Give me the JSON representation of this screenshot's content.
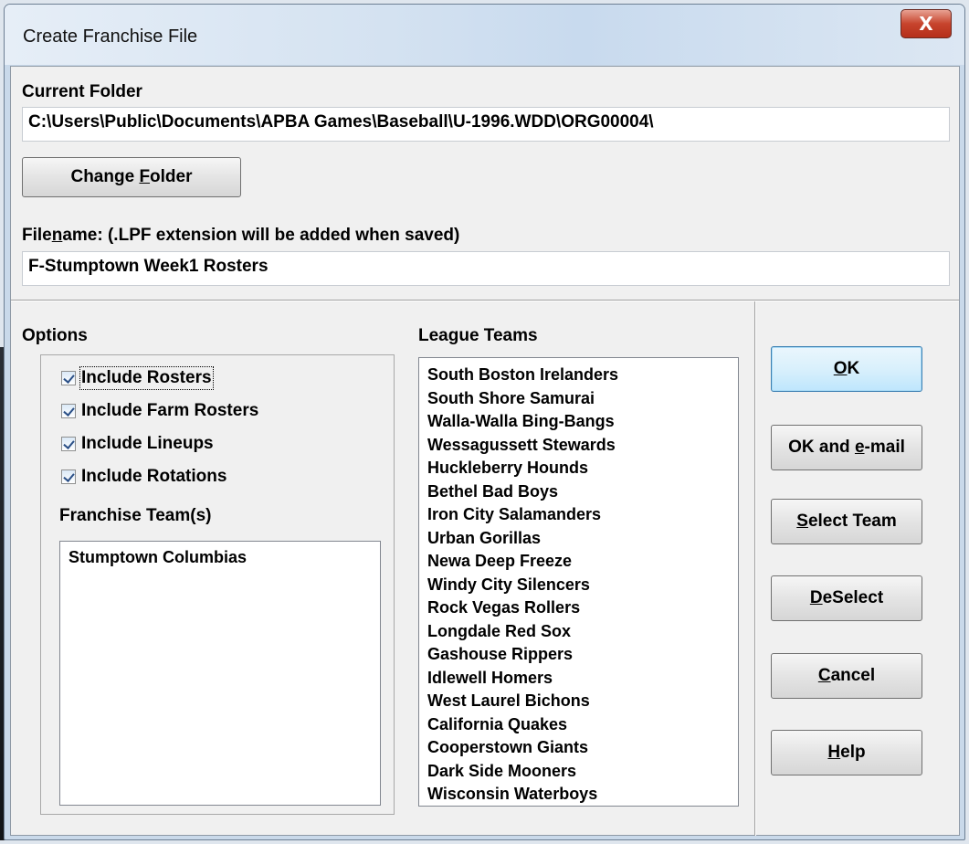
{
  "window": {
    "title": "Create Franchise File",
    "close_glyph": "X"
  },
  "current_folder": {
    "label": "Current Folder",
    "value": "C:\\Users\\Public\\Documents\\APBA Games\\Baseball\\U-1996.WDD\\ORG00004\\"
  },
  "change_folder_button": {
    "prefix": "Change ",
    "mnemonic": "F",
    "suffix": "older"
  },
  "filename": {
    "label_prefix": "File",
    "label_mnemonic": "n",
    "label_suffix": "ame: (.LPF extension will be added when saved)",
    "value": "F-Stumptown Week1 Rosters"
  },
  "options": {
    "label": "Options",
    "checkboxes": [
      {
        "label": "Include Rosters",
        "checked": true
      },
      {
        "label": "Include Farm Rosters",
        "checked": true
      },
      {
        "label": "Include Lineups",
        "checked": true
      },
      {
        "label": "Include Rotations",
        "checked": true
      }
    ]
  },
  "franchise_teams": {
    "label": "Franchise Team(s)",
    "items": [
      "Stumptown Columbias"
    ]
  },
  "league_teams": {
    "label": "League Teams",
    "items": [
      "South Boston Irelanders",
      "South Shore Samurai",
      "Walla-Walla Bing-Bangs",
      "Wessagussett Stewards",
      "Huckleberry Hounds",
      "Bethel Bad Boys",
      "Iron City Salamanders",
      "Urban Gorillas",
      "Newa Deep Freeze",
      "Windy City Silencers",
      "Rock Vegas Rollers",
      "Longdale Red Sox",
      "Gashouse Rippers",
      "Idlewell Homers",
      "West Laurel Bichons",
      "California Quakes",
      "Cooperstown Giants",
      "Dark Side Mooners",
      "Wisconsin Waterboys"
    ]
  },
  "buttons": {
    "ok": {
      "prefix": "",
      "mnemonic": "O",
      "suffix": "K"
    },
    "ok_email": {
      "prefix": "OK and ",
      "mnemonic": "e",
      "suffix": "-mail"
    },
    "select_team": {
      "prefix": "",
      "mnemonic": "S",
      "suffix": "elect Team"
    },
    "deselect": {
      "prefix": "",
      "mnemonic": "D",
      "suffix": "eSelect"
    },
    "cancel": {
      "prefix": "",
      "mnemonic": "C",
      "suffix": "ancel"
    },
    "help": {
      "prefix": "",
      "mnemonic": "H",
      "suffix": "elp"
    }
  }
}
